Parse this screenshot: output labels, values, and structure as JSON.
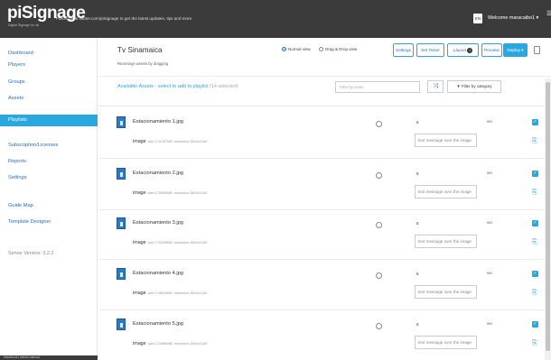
{
  "header": {
    "logo": "piSignage",
    "logo_sub": "Digital Signage for all",
    "follow_text": "Follow us at twitter.com/piSignage to get the latest updates, tips and more",
    "lang": "EN",
    "welcome": "Welcome maracaibo1 ▾",
    "edge_icon": "☰"
  },
  "sidebar": {
    "items": [
      {
        "label": "Dashboard"
      },
      {
        "label": "Players"
      },
      {
        "label": "Groups"
      },
      {
        "label": "Assets"
      },
      {
        "label": "Playlists"
      },
      {
        "label": "Subscription/Licenses"
      },
      {
        "label": "Reports"
      },
      {
        "label": "Settings"
      },
      {
        "label": "Guide Map"
      },
      {
        "label": "Template Designer"
      }
    ],
    "server_version": "Server Version: 3.2.2",
    "bottom_text": "Handbook | Admin manual"
  },
  "playlist": {
    "title": "Tv Sinamaica",
    "subtitle": "Rearrange assets by dragging",
    "view_normal": "Normal view",
    "view_drag": "Drag & Drop view",
    "buttons": {
      "settings": "Settings",
      "set_ticker": "Set Ticker",
      "layout": "Layout",
      "layout_badge": "1",
      "preview": "Preview",
      "deploy": "Deploy ▾"
    },
    "available_label": "Available Assets - select to add to playlist",
    "available_selected": "(14 selected)",
    "filter_placeholder": "Filter by name",
    "shuffle_icon": "⤨",
    "filter_category": "▼ Filter by category"
  },
  "assets": [
    {
      "name": "Estacionamiento 1.jpg",
      "type": "image",
      "size": "size:1.41287MB",
      "resolution": "resolution:3840x2160",
      "duration": "5",
      "unit": "sec",
      "message_placeholder": "text message over the image"
    },
    {
      "name": "Estacionamiento 2.jpg",
      "type": "image",
      "size": "size:1.33659MB",
      "resolution": "resolution:3840x2160",
      "duration": "5",
      "unit": "sec",
      "message_placeholder": "text message over the image"
    },
    {
      "name": "Estacionamiento 3.jpg",
      "type": "image",
      "size": "size:1.53208MB",
      "resolution": "resolution:3840x2160",
      "duration": "5",
      "unit": "sec",
      "message_placeholder": "text message over the image"
    },
    {
      "name": "Estacionamiento 4.jpg",
      "type": "image",
      "size": "size:1.48819MB",
      "resolution": "resolution:3840x2160",
      "duration": "5",
      "unit": "sec",
      "message_placeholder": "text message over the image"
    },
    {
      "name": "Estacionamiento 5.jpg",
      "type": "image",
      "size": "size:2.24866MB",
      "resolution": "resolution:3840x2160",
      "duration": "5",
      "unit": "sec",
      "message_placeholder": "text message over the image"
    }
  ],
  "colors": {
    "accent": "#29a8e0",
    "topbar": "#3b3b3b",
    "link": "#2a6fb5"
  }
}
